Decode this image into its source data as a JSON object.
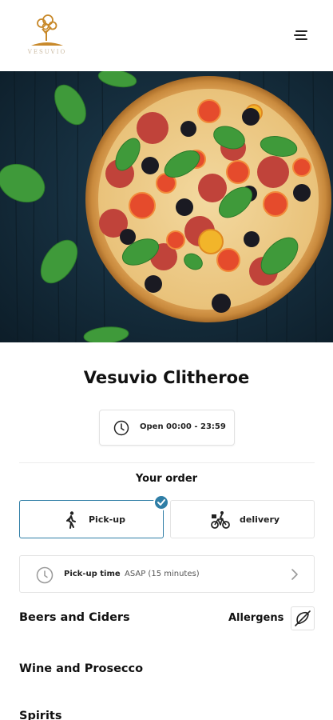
{
  "header": {
    "logo_text": "VESUVIO",
    "logo_icon": "tree-logo-icon",
    "menu_icon": "hamburger-menu-icon"
  },
  "hero": {
    "image": "pizza-hero-image"
  },
  "restaurant": {
    "name": "Vesuvio Clitheroe",
    "hours": "Open 00:00 - 23:59"
  },
  "order": {
    "title": "Your order",
    "options": [
      {
        "label": "Pick-up",
        "icon": "walking-person-icon",
        "selected": true
      },
      {
        "label": "delivery",
        "icon": "bicycle-courier-icon",
        "selected": false
      }
    ],
    "pickup_time": {
      "label": "Pick-up time",
      "value": "ASAP (15 minutes)"
    }
  },
  "menu": {
    "categories": [
      "Beers and Ciders",
      "Wine and Prosecco",
      "Spirits"
    ],
    "allergens_label": "Allergens"
  },
  "colors": {
    "accent": "#2f7ea6",
    "logo_gold": "#c8892a",
    "border": "#e4e4e4"
  }
}
